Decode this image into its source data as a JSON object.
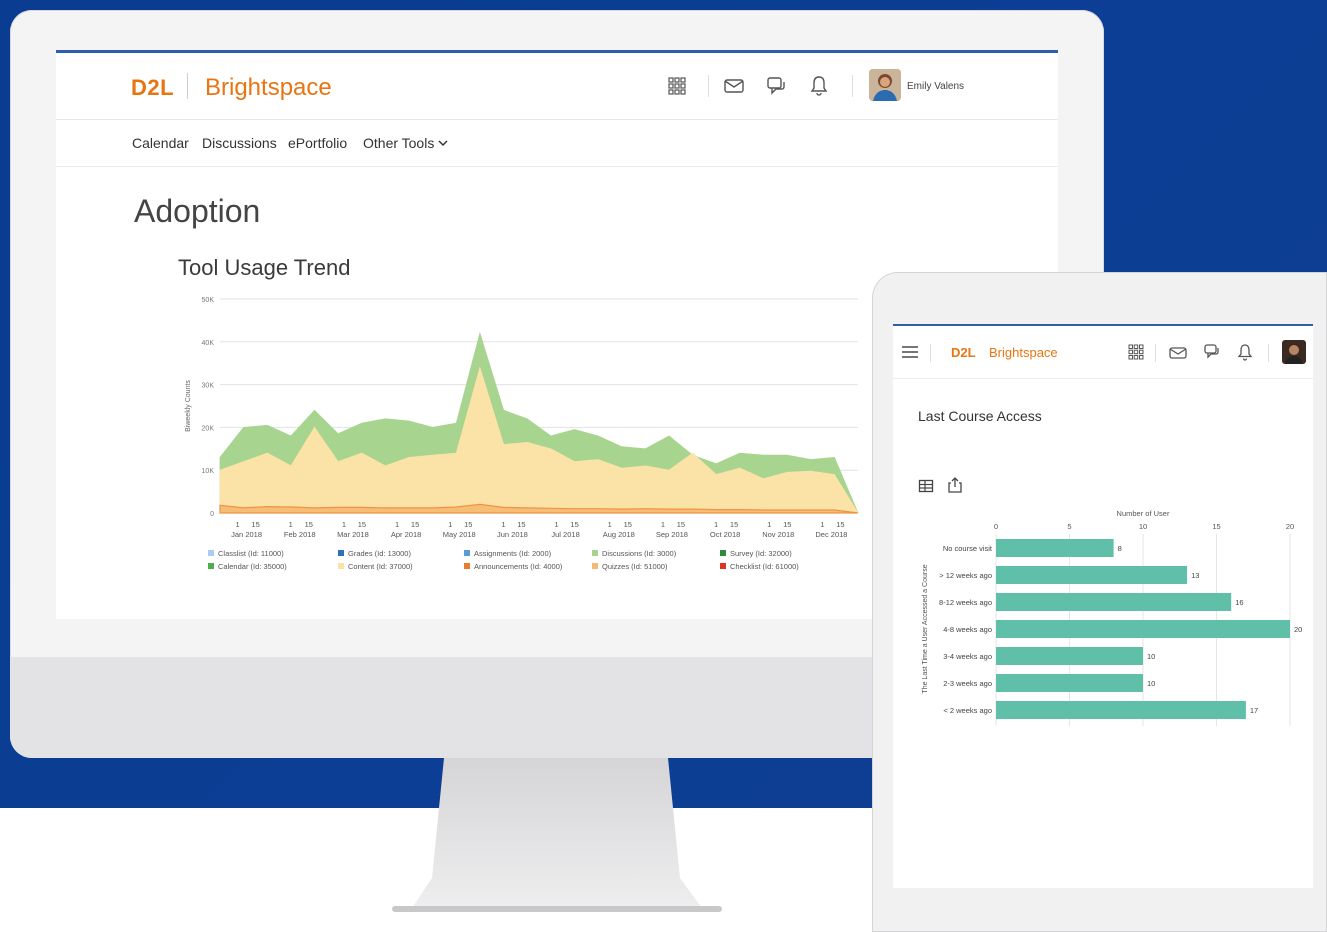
{
  "desktop": {
    "brand": {
      "short": "D2L",
      "name": "Brightspace"
    },
    "user": {
      "name": "Emily Valens"
    },
    "nav": {
      "items": [
        "Calendar",
        "Discussions",
        "ePortfolio",
        "Other Tools"
      ]
    },
    "page_title": "Adoption",
    "chart_title": "Tool Usage Trend"
  },
  "tablet": {
    "brand": {
      "short": "D2L",
      "name": "Brightspace"
    },
    "section_title": "Last Course Access"
  },
  "colors": {
    "brand": "#e87511",
    "accent_blue": "#2f5fa8",
    "background": "#0b3e94",
    "bar": "#5fbfa8"
  },
  "chart_data": [
    {
      "type": "area",
      "title": "Tool Usage Trend",
      "ylabel": "Biweekly Counts",
      "xlabel": "",
      "ylim": [
        0,
        50000
      ],
      "y_ticks": [
        "0",
        "10K",
        "20K",
        "30K",
        "40K",
        "50K"
      ],
      "x_tick_days": [
        "1",
        "15"
      ],
      "x_tick_months": [
        "Jan 2018",
        "Feb 2018",
        "Mar 2018",
        "Apr 2018",
        "May 2018",
        "Jun 2018",
        "Jul 2018",
        "Aug 2018",
        "Sep 2018",
        "Oct 2018",
        "Nov 2018",
        "Dec 2018"
      ],
      "x_points": [
        "Jan 1",
        "Jan 15",
        "Feb 1",
        "Feb 15",
        "Mar 1",
        "Mar 15",
        "Apr 1",
        "Apr 15",
        "May 1",
        "May 15",
        "Jun 1",
        "Jun 15",
        "Jul 1",
        "Jul 15",
        "Aug 1",
        "Aug 15",
        "Sep 1",
        "Sep 15",
        "Oct 1",
        "Oct 15",
        "Nov 1",
        "Nov 15",
        "Dec 1",
        "Dec 15"
      ],
      "series": [
        {
          "name": "Content (Id: 37000)",
          "color": "#fbe2a6",
          "values": [
            10000,
            12000,
            14000,
            11000,
            20000,
            12000,
            14000,
            11000,
            13000,
            13500,
            14000,
            34000,
            16000,
            16500,
            15000,
            12000,
            12500,
            10500,
            11000,
            10000,
            14000,
            9000,
            10500,
            8000,
            9500,
            9800,
            9000,
            0
          ]
        },
        {
          "name": "Discussions (Id: 3000)",
          "color": "#a7d48e",
          "values": [
            13000,
            20000,
            20500,
            18000,
            24000,
            18500,
            21000,
            22000,
            21500,
            20000,
            21000,
            42000,
            24000,
            22000,
            18000,
            19500,
            18000,
            15500,
            15000,
            18000,
            13500,
            11500,
            14000,
            13500,
            13500,
            12500,
            13000,
            0
          ]
        },
        {
          "name": "Quizzes (Id: 51000)",
          "color": "#f5b971",
          "values": [
            1800,
            1200,
            1500,
            1400,
            1200,
            1300,
            1300,
            1200,
            1200,
            1200,
            1400,
            2000,
            1300,
            1200,
            1100,
            1000,
            1000,
            900,
            1000,
            900,
            900,
            800,
            800,
            700,
            700,
            700,
            700,
            0
          ]
        },
        {
          "name": "Classlist (Id: 11000)",
          "color": "#a9cdf0",
          "values": []
        },
        {
          "name": "Grades (Id: 13000)",
          "color": "#2c6fbb",
          "values": []
        },
        {
          "name": "Assignments (Id: 2000)",
          "color": "#5b9bd5",
          "values": []
        },
        {
          "name": "Survey (Id: 32000)",
          "color": "#2e8b3d",
          "values": []
        },
        {
          "name": "Calendar (Id: 35000)",
          "color": "#4cae4f",
          "values": []
        },
        {
          "name": "Announcements (Id: 4000)",
          "color": "#e97b2e",
          "values": []
        },
        {
          "name": "Checklist (Id: 61000)",
          "color": "#d9381e",
          "values": []
        }
      ]
    },
    {
      "type": "bar",
      "title": "",
      "xlabel": "Number of User",
      "ylabel": "The Last Time a User Accessed a Course",
      "xlim": [
        0,
        20
      ],
      "x_ticks": [
        "0",
        "5",
        "10",
        "15",
        "20"
      ],
      "categories": [
        "No course visit",
        "> 12 weeks ago",
        "8-12 weeks ago",
        "4-8 weeks ago",
        "3-4 weeks ago",
        "2-3 weeks ago",
        "< 2 weeks ago"
      ],
      "values": [
        8,
        13,
        16,
        20,
        10,
        10,
        17
      ]
    }
  ]
}
